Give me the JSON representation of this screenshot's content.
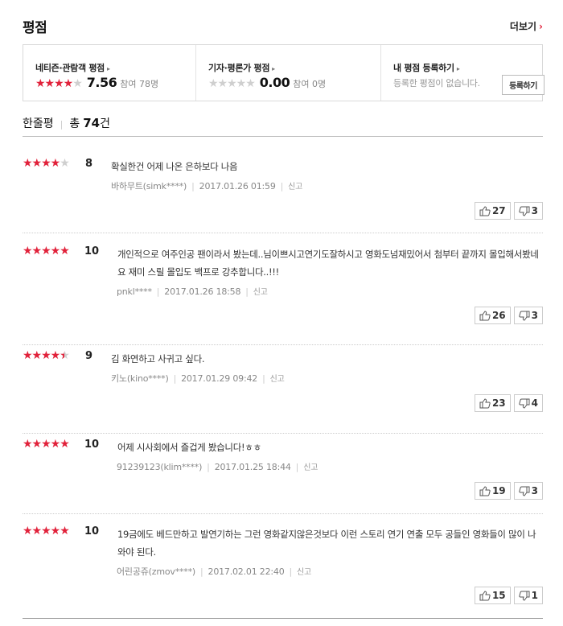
{
  "header": {
    "title": "평점",
    "more_label": "더보기",
    "more_arrow": "›"
  },
  "summary": {
    "netizen": {
      "label": "네티즌·관람객 평점",
      "stars_on": "★★★★",
      "stars_off": "★",
      "score": "7.56",
      "participants": "참여 78명"
    },
    "critic": {
      "label": "기자·평론가 평점",
      "stars_on": "",
      "stars_off": "★★★★★",
      "score": "0.00",
      "participants": "참여 0명"
    },
    "mine": {
      "label": "내 평점 등록하기",
      "message": "등록한 평점이 없습니다.",
      "button_label": "등록하기"
    },
    "arrow": "▸"
  },
  "short_reviews": {
    "label": "한줄평",
    "total_prefix": "총",
    "total_count": "74",
    "total_suffix": "건"
  },
  "reviews": [
    {
      "stars_on": "★★★★",
      "stars_off": "★",
      "score": "8",
      "text": "확실한건 어제 나온 은하보다 나음",
      "user": "바하무트(simk****)",
      "date": "2017.01.26 01:59",
      "report": "신고",
      "likes": "27",
      "dislikes": "3"
    },
    {
      "stars_on": "★★★★★",
      "stars_off": "",
      "score": "10",
      "text": "개인적으로 여주인공 팬이라서 봤는데..님이쁘시고연기도잘하시고 영화도넘재밌어서 첨부터 끝까지 몰입해서봤네요 재미 스릴 몰입도 백프로 강추합니다..!!!",
      "user": "pnkl****",
      "date": "2017.01.26 18:58",
      "report": "신고",
      "likes": "26",
      "dislikes": "3"
    },
    {
      "stars_on": "★★★★",
      "stars_off": "",
      "score": "9",
      "text": "김 화연하고 사귀고 싶다.",
      "user": "키노(kino****)",
      "date": "2017.01.29 09:42",
      "report": "신고",
      "likes": "23",
      "dislikes": "4"
    },
    {
      "stars_on": "★★★★★",
      "stars_off": "",
      "score": "10",
      "text": "어제 시사회에서 즐겁게 봤습니다!ㅎㅎ",
      "user": "91239123(klim****)",
      "date": "2017.01.25 18:44",
      "report": "신고",
      "likes": "19",
      "dislikes": "3"
    },
    {
      "stars_on": "★★★★★",
      "stars_off": "",
      "score": "10",
      "text": "19금에도 베드만하고 발연기하는 그런 영화같지않은것보다 이런 스토리 연기 연출 모두 공들인 영화들이 많이 나와야 된다.",
      "user": "어린공쥬(zmov****)",
      "date": "2017.02.01 22:40",
      "report": "신고",
      "likes": "15",
      "dislikes": "1"
    }
  ],
  "colors": {
    "accent": "#e1213a",
    "star_off": "#cfcfcf"
  },
  "icons": {
    "like": "thumbs-up-icon",
    "dislike": "thumbs-down-icon"
  }
}
